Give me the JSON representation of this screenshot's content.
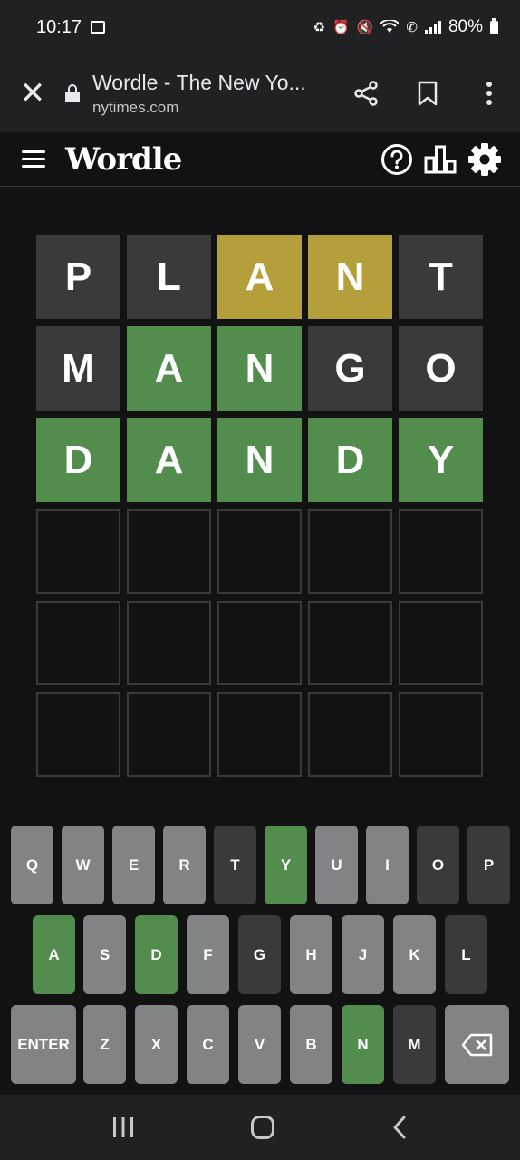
{
  "status_bar": {
    "time": "10:17",
    "battery": "80%"
  },
  "browser": {
    "page_title": "Wordle - The New Yo...",
    "domain": "nytimes.com"
  },
  "header": {
    "title": "Wordle"
  },
  "colors": {
    "correct": "#538d4e",
    "present": "#b59f3b",
    "absent": "#3a3a3c",
    "unused_key": "#818384",
    "background": "#121213"
  },
  "board": [
    [
      {
        "letter": "P",
        "state": "absent"
      },
      {
        "letter": "L",
        "state": "absent"
      },
      {
        "letter": "A",
        "state": "present"
      },
      {
        "letter": "N",
        "state": "present"
      },
      {
        "letter": "T",
        "state": "absent"
      }
    ],
    [
      {
        "letter": "M",
        "state": "absent"
      },
      {
        "letter": "A",
        "state": "correct"
      },
      {
        "letter": "N",
        "state": "correct"
      },
      {
        "letter": "G",
        "state": "absent"
      },
      {
        "letter": "O",
        "state": "absent"
      }
    ],
    [
      {
        "letter": "D",
        "state": "correct"
      },
      {
        "letter": "A",
        "state": "correct"
      },
      {
        "letter": "N",
        "state": "correct"
      },
      {
        "letter": "D",
        "state": "correct"
      },
      {
        "letter": "Y",
        "state": "correct"
      }
    ],
    [
      {
        "letter": "",
        "state": "empty"
      },
      {
        "letter": "",
        "state": "empty"
      },
      {
        "letter": "",
        "state": "empty"
      },
      {
        "letter": "",
        "state": "empty"
      },
      {
        "letter": "",
        "state": "empty"
      }
    ],
    [
      {
        "letter": "",
        "state": "empty"
      },
      {
        "letter": "",
        "state": "empty"
      },
      {
        "letter": "",
        "state": "empty"
      },
      {
        "letter": "",
        "state": "empty"
      },
      {
        "letter": "",
        "state": "empty"
      }
    ],
    [
      {
        "letter": "",
        "state": "empty"
      },
      {
        "letter": "",
        "state": "empty"
      },
      {
        "letter": "",
        "state": "empty"
      },
      {
        "letter": "",
        "state": "empty"
      },
      {
        "letter": "",
        "state": "empty"
      }
    ]
  ],
  "keyboard": {
    "rows": [
      [
        {
          "label": "Q",
          "state": "unused"
        },
        {
          "label": "W",
          "state": "unused"
        },
        {
          "label": "E",
          "state": "unused"
        },
        {
          "label": "R",
          "state": "unused"
        },
        {
          "label": "T",
          "state": "absent"
        },
        {
          "label": "Y",
          "state": "correct"
        },
        {
          "label": "U",
          "state": "unused"
        },
        {
          "label": "I",
          "state": "unused"
        },
        {
          "label": "O",
          "state": "absent"
        },
        {
          "label": "P",
          "state": "absent"
        }
      ],
      [
        {
          "label": "A",
          "state": "correct"
        },
        {
          "label": "S",
          "state": "unused"
        },
        {
          "label": "D",
          "state": "correct"
        },
        {
          "label": "F",
          "state": "unused"
        },
        {
          "label": "G",
          "state": "absent"
        },
        {
          "label": "H",
          "state": "unused"
        },
        {
          "label": "J",
          "state": "unused"
        },
        {
          "label": "K",
          "state": "unused"
        },
        {
          "label": "L",
          "state": "absent"
        }
      ],
      [
        {
          "label": "ENTER",
          "state": "unused"
        },
        {
          "label": "Z",
          "state": "unused"
        },
        {
          "label": "X",
          "state": "unused"
        },
        {
          "label": "C",
          "state": "unused"
        },
        {
          "label": "V",
          "state": "unused"
        },
        {
          "label": "B",
          "state": "unused"
        },
        {
          "label": "N",
          "state": "correct"
        },
        {
          "label": "M",
          "state": "absent"
        },
        {
          "label": "",
          "state": "unused",
          "icon": "backspace-icon"
        }
      ]
    ]
  }
}
